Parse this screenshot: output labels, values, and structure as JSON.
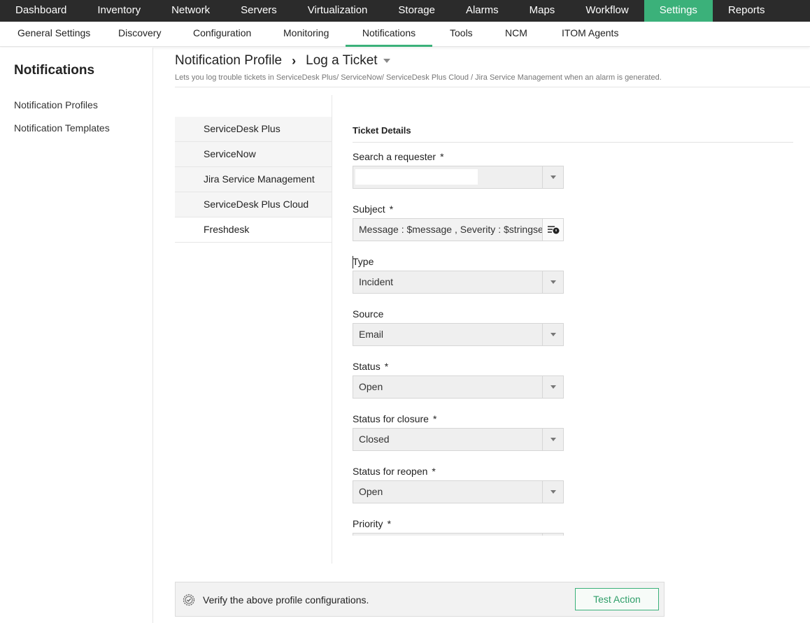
{
  "topnav": {
    "items": [
      {
        "label": "Dashboard"
      },
      {
        "label": "Inventory"
      },
      {
        "label": "Network"
      },
      {
        "label": "Servers"
      },
      {
        "label": "Virtualization"
      },
      {
        "label": "Storage"
      },
      {
        "label": "Alarms"
      },
      {
        "label": "Maps"
      },
      {
        "label": "Workflow"
      },
      {
        "label": "Settings"
      },
      {
        "label": "Reports"
      }
    ],
    "active": "Settings",
    "accent_color": "#3bb17a"
  },
  "subnav": {
    "items": [
      {
        "label": "General Settings"
      },
      {
        "label": "Discovery"
      },
      {
        "label": "Configuration"
      },
      {
        "label": "Monitoring"
      },
      {
        "label": "Notifications"
      },
      {
        "label": "Tools"
      },
      {
        "label": "NCM"
      },
      {
        "label": "ITOM Agents"
      }
    ],
    "active": "Notifications"
  },
  "sidebar": {
    "title": "Notifications",
    "links": [
      {
        "label": "Notification Profiles"
      },
      {
        "label": "Notification Templates"
      }
    ]
  },
  "header": {
    "crumb_root": "Notification Profile",
    "crumb_current": "Log a Ticket",
    "description": "Lets you log trouble tickets in ServiceDesk Plus/ ServiceNow/ ServiceDesk Plus Cloud / Jira Service Management when an alarm is generated."
  },
  "providers": {
    "items": [
      {
        "label": "ServiceDesk Plus"
      },
      {
        "label": "ServiceNow"
      },
      {
        "label": "Jira Service Management"
      },
      {
        "label": "ServiceDesk Plus Cloud"
      },
      {
        "label": "Freshdesk"
      }
    ],
    "selected": "Freshdesk"
  },
  "form": {
    "section_title": "Ticket Details",
    "requester": {
      "label": "Search a requester",
      "required": "*",
      "value": ""
    },
    "subject": {
      "label": "Subject",
      "required": "*",
      "value": "Message : $message , Severity : $stringseverity"
    },
    "type": {
      "label": "Type",
      "value": "Incident"
    },
    "source": {
      "label": "Source",
      "value": "Email"
    },
    "status": {
      "label": "Status",
      "required": "*",
      "value": "Open"
    },
    "status_closure": {
      "label": "Status for closure",
      "required": "*",
      "value": "Closed"
    },
    "status_reopen": {
      "label": "Status for reopen",
      "required": "*",
      "value": "Open"
    },
    "priority": {
      "label": "Priority",
      "required": "*",
      "value": ""
    }
  },
  "verify": {
    "text": "Verify the above profile configurations.",
    "button_label": "Test Action"
  }
}
